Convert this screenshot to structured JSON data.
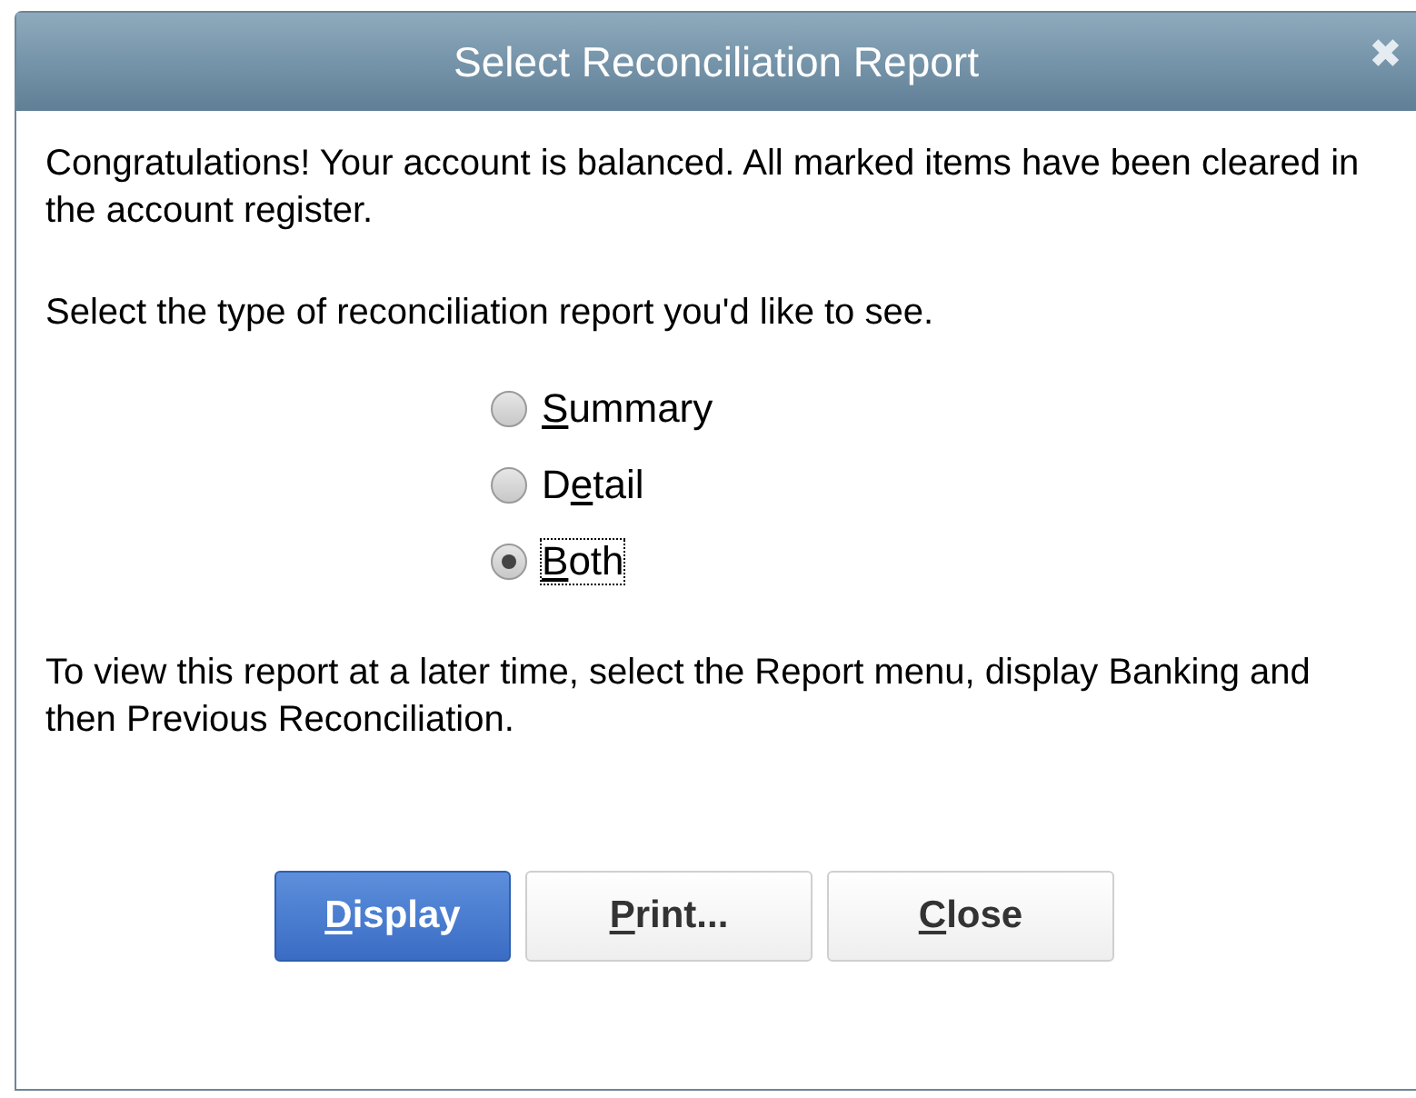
{
  "window": {
    "title": "Select Reconciliation Report",
    "close": "✖"
  },
  "message": "Congratulations! Your account is balanced. All marked items have been cleared in the account register.",
  "prompt": "Select the type of reconciliation report you'd like to see.",
  "options": [
    {
      "key": "S",
      "post": "ummary",
      "selected": false,
      "focused": false
    },
    {
      "pre": "D",
      "key": "e",
      "post": "tail",
      "selected": false,
      "focused": false
    },
    {
      "key": "B",
      "post": "oth",
      "selected": true,
      "focused": true
    }
  ],
  "note": "To view this report at a later time, select the Report menu, display Banking and then Previous Reconciliation.",
  "buttons": [
    {
      "key": "D",
      "post": "isplay",
      "default": true
    },
    {
      "key": "P",
      "post": "rint...",
      "default": false
    },
    {
      "key": "C",
      "post": "lose",
      "default": false
    }
  ]
}
